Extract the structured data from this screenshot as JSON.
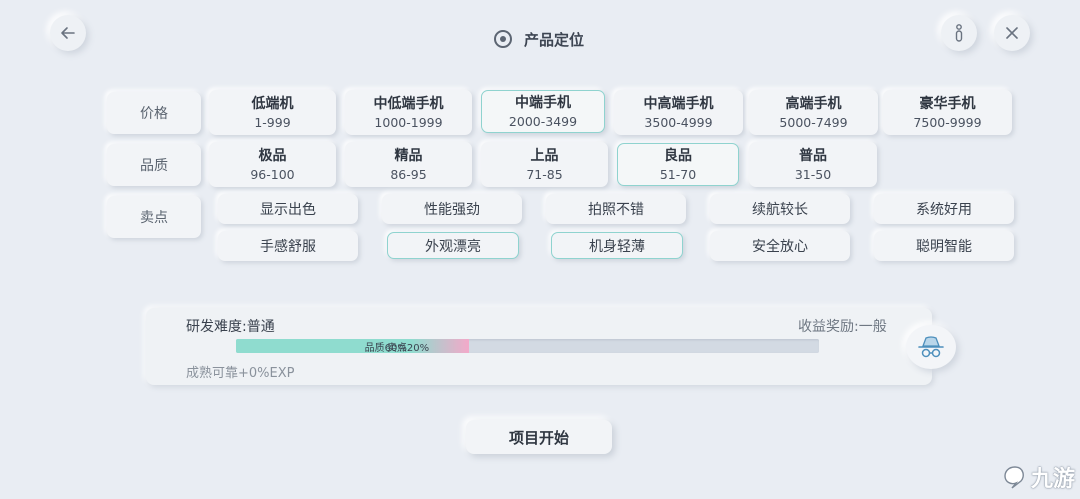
{
  "header": {
    "title": "产品定位"
  },
  "rows": {
    "price_label": "价格",
    "quality_label": "品质",
    "selling_label": "卖点"
  },
  "price": [
    {
      "name": "低端机",
      "range": "1-999",
      "selected": false
    },
    {
      "name": "中低端手机",
      "range": "1000-1999",
      "selected": false
    },
    {
      "name": "中端手机",
      "range": "2000-3499",
      "selected": true
    },
    {
      "name": "中高端手机",
      "range": "3500-4999",
      "selected": false
    },
    {
      "name": "高端手机",
      "range": "5000-7499",
      "selected": false
    },
    {
      "name": "豪华手机",
      "range": "7500-9999",
      "selected": false
    }
  ],
  "quality": [
    {
      "name": "极品",
      "range": "96-100",
      "selected": false
    },
    {
      "name": "精品",
      "range": "86-95",
      "selected": false
    },
    {
      "name": "上品",
      "range": "71-85",
      "selected": false
    },
    {
      "name": "良品",
      "range": "51-70",
      "selected": true
    },
    {
      "name": "普品",
      "range": "31-50",
      "selected": false
    }
  ],
  "selling_points": [
    {
      "name": "显示出色",
      "selected": false
    },
    {
      "name": "性能强劲",
      "selected": false
    },
    {
      "name": "拍照不错",
      "selected": false
    },
    {
      "name": "续航较长",
      "selected": false
    },
    {
      "name": "系统好用",
      "selected": false
    },
    {
      "name": "手感舒服",
      "selected": false
    },
    {
      "name": "外观漂亮",
      "selected": true
    },
    {
      "name": "机身轻薄",
      "selected": true
    },
    {
      "name": "安全放心",
      "selected": false
    },
    {
      "name": "聪明智能",
      "selected": false
    }
  ],
  "summary": {
    "difficulty": "研发难度:普通",
    "reward": "收益奖励:一般",
    "quality_seg_label": "品质60%",
    "quality_seg_value": 60,
    "selling_seg_label": "卖点20%",
    "selling_seg_value": 20,
    "exp_note": "成熟可靠+0%EXP",
    "colors": {
      "quality": "#8fdccf",
      "selling": "#f3a9c9"
    }
  },
  "start_button": "项目开始",
  "watermark": "九游",
  "icons": {
    "back": "back-arrow-icon",
    "close": "close-icon",
    "info": "info-icon",
    "target": "target-icon",
    "spy": "incognito-icon"
  }
}
